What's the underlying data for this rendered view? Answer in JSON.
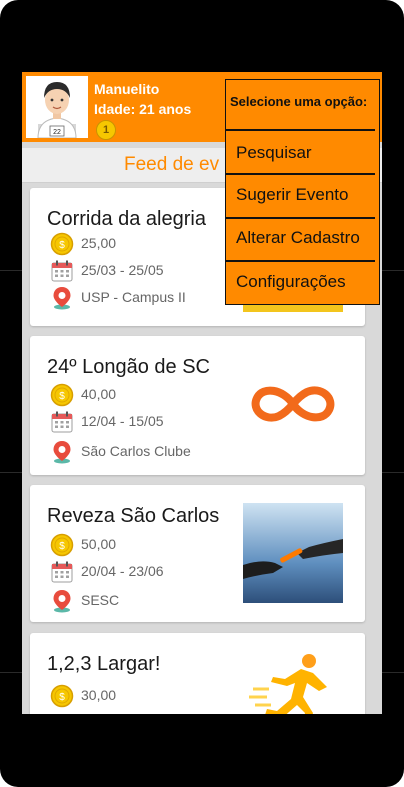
{
  "profile": {
    "name": "Manuelito",
    "age": "Idade: 21 anos",
    "level": "1",
    "bib_number": "22"
  },
  "feed": {
    "title": "Feed de ev"
  },
  "events": [
    {
      "title": "Corrida da alegria",
      "price": "25,00",
      "dates": "25/03 - 25/05",
      "location": "USP - Campus II"
    },
    {
      "title": "24º Longão de SC",
      "price": "40,00",
      "dates": "12/04 - 15/05",
      "location": "São Carlos Clube"
    },
    {
      "title": "Reveza São Carlos",
      "price": "50,00",
      "dates": "20/04 - 23/06",
      "location": "SESC"
    },
    {
      "title": "1,2,3 Largar!",
      "price": "30,00"
    }
  ],
  "menu": {
    "header": "Selecione uma opção:",
    "items": [
      "Pesquisar",
      "Sugerir Evento",
      "Alterar Cadastro",
      "Configurações"
    ]
  },
  "colors": {
    "accent": "#ff8a00",
    "coin": "#f6c700",
    "calendar": "#e65a5a",
    "pin": "#e84c3d"
  }
}
